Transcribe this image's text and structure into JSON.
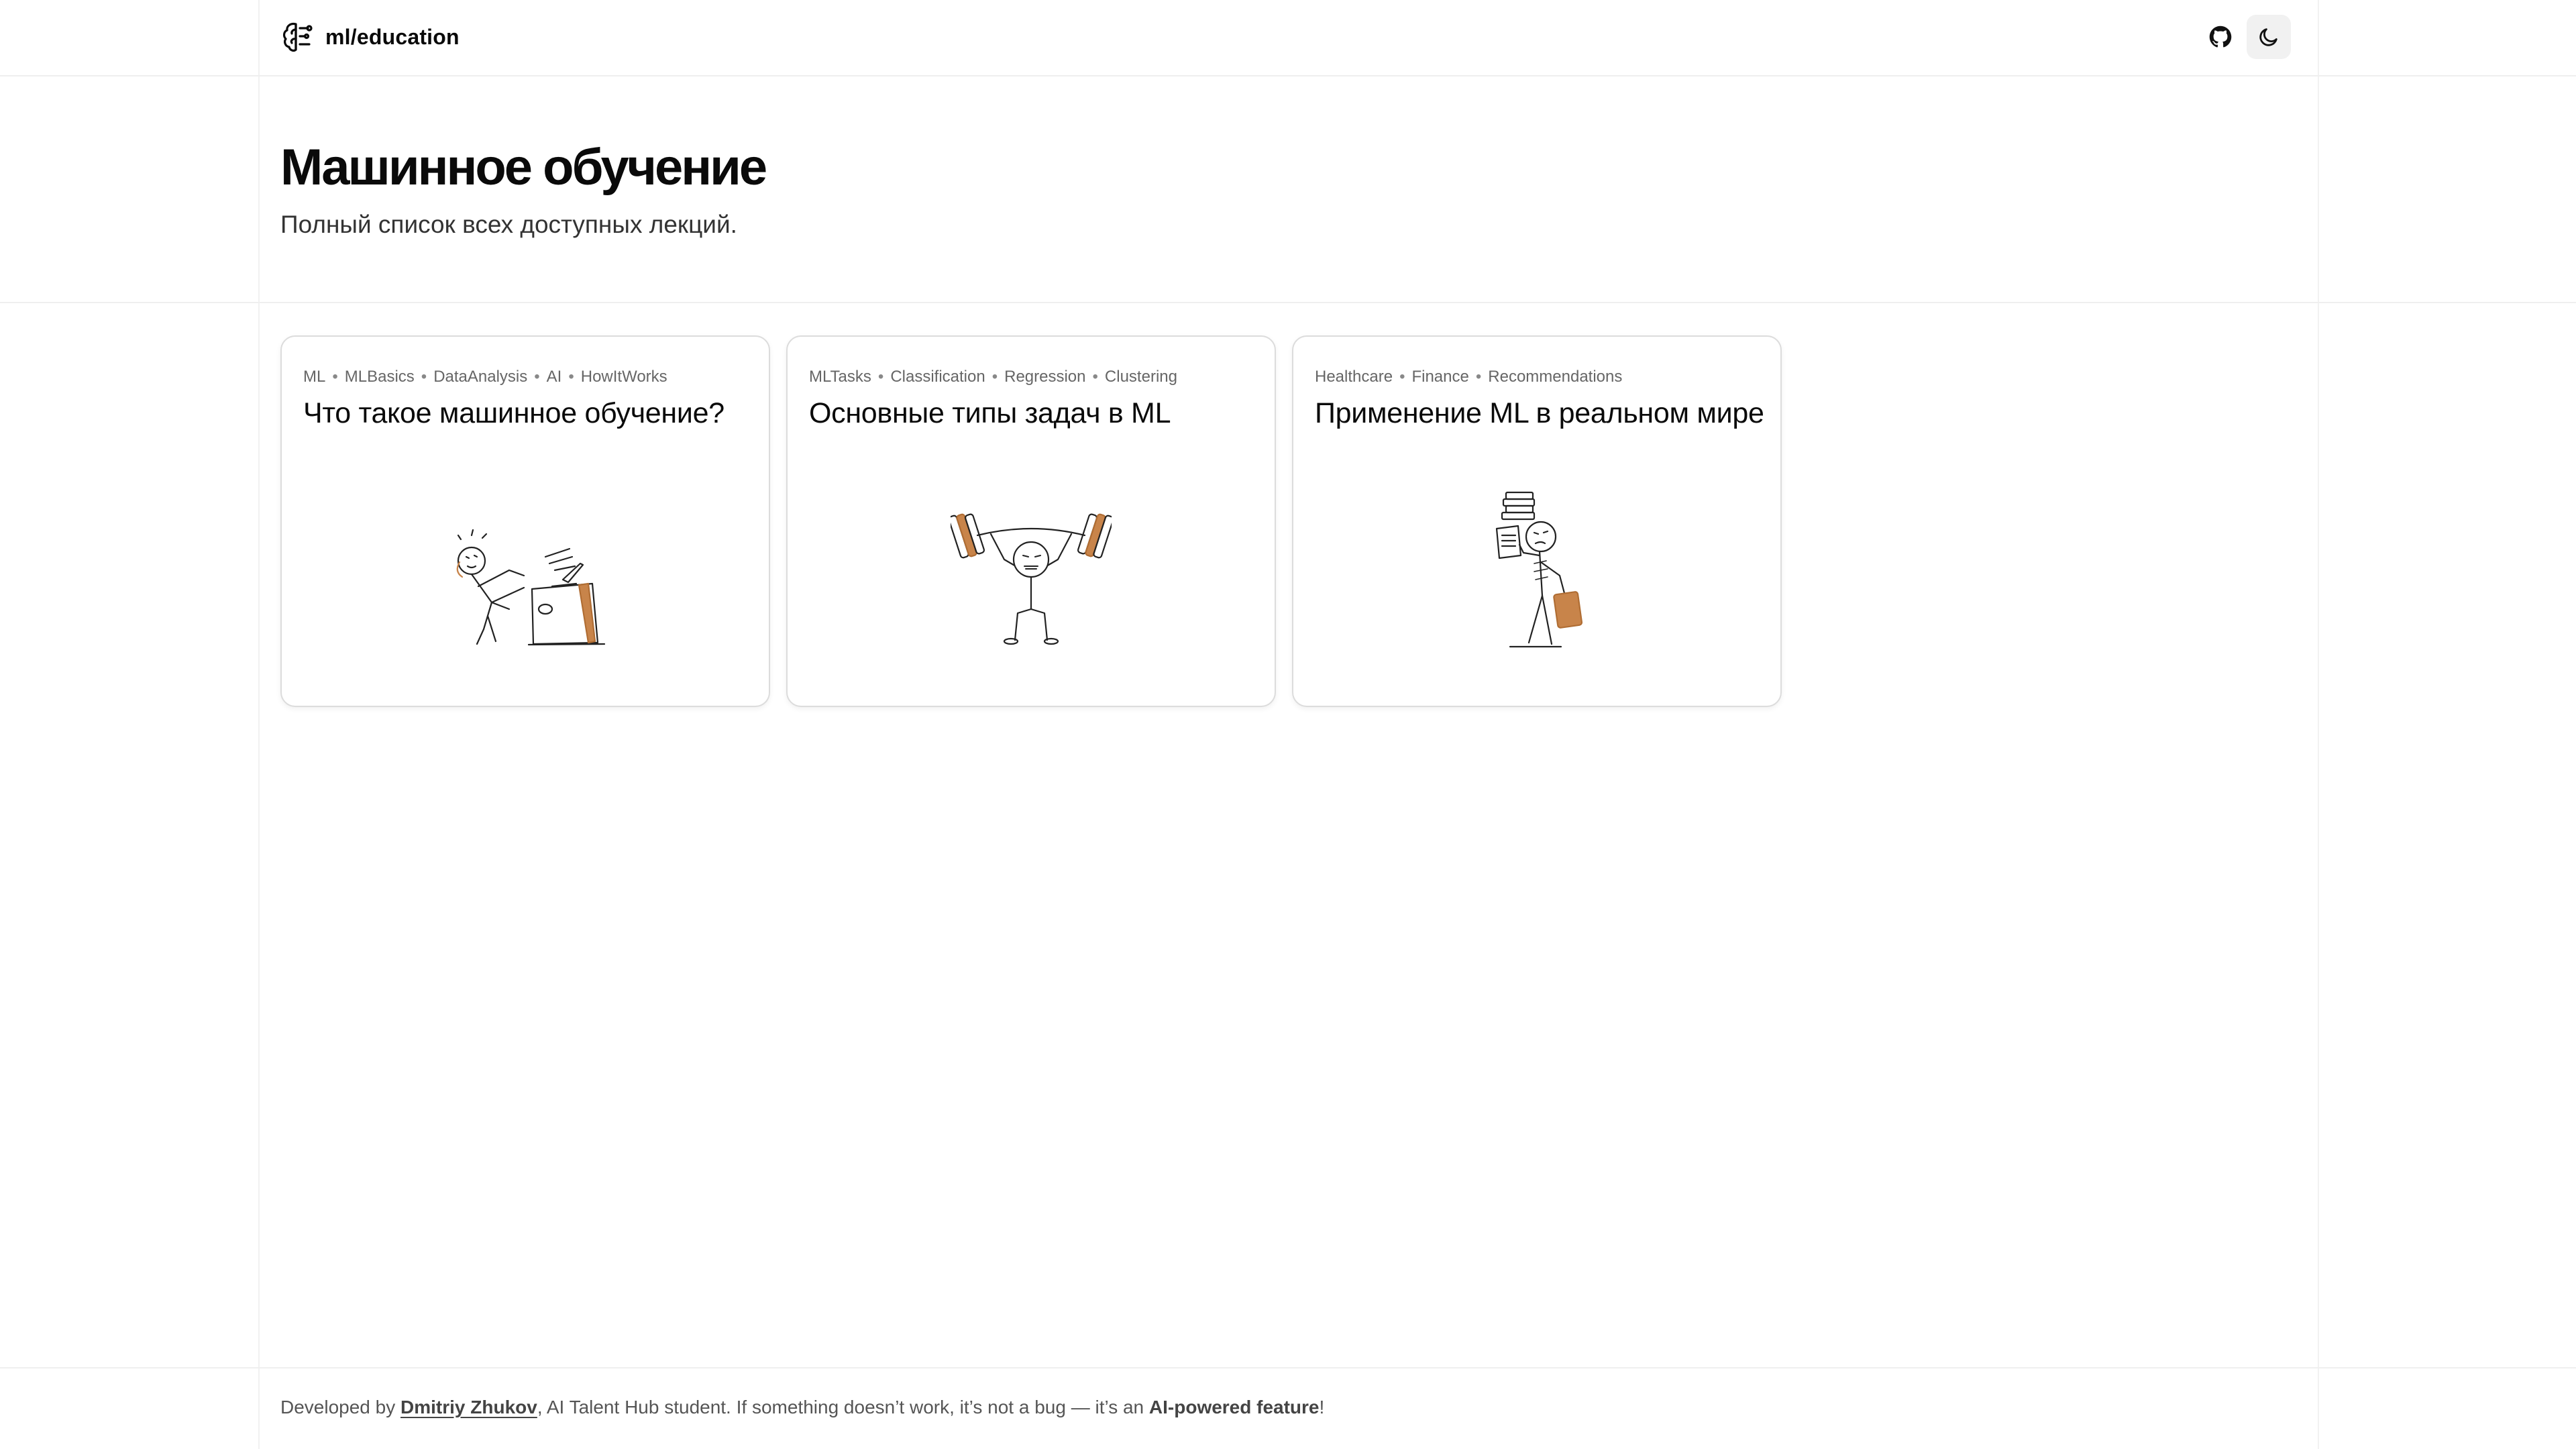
{
  "header": {
    "brand": "ml/education",
    "icons": {
      "brand": "brain-icon",
      "github": "github-icon",
      "theme": "moon-icon"
    }
  },
  "hero": {
    "title": "Машинное обучение",
    "subtitle": "Полный список всех доступных лекций."
  },
  "cards": [
    {
      "tags": [
        "ML",
        "MLBasics",
        "DataAnalysis",
        "AI",
        "HowItWorks"
      ],
      "title": "Что такое машинное обучение?",
      "illustration": "stickman-at-desk-illustration"
    },
    {
      "tags": [
        "MLTasks",
        "Classification",
        "Regression",
        "Clustering"
      ],
      "title": "Основные типы задач в ML",
      "illustration": "stickman-weightlifter-illustration"
    },
    {
      "tags": [
        "Healthcare",
        "Finance",
        "Recommendations"
      ],
      "title": "Применение ML в реальном мире",
      "illustration": "stickman-carrying-books-illustration"
    }
  ],
  "footer": {
    "prefix": "Developed by ",
    "author": "Dmitriy Zhukov",
    "middle": ", AI Talent Hub student. If something doesn’t work, it’s not a bug — it’s an ",
    "feature": "AI-powered feature",
    "suffix": "!"
  },
  "colors": {
    "accent": "#c8844a",
    "border": "#dcdcdc",
    "muted": "#666666"
  }
}
